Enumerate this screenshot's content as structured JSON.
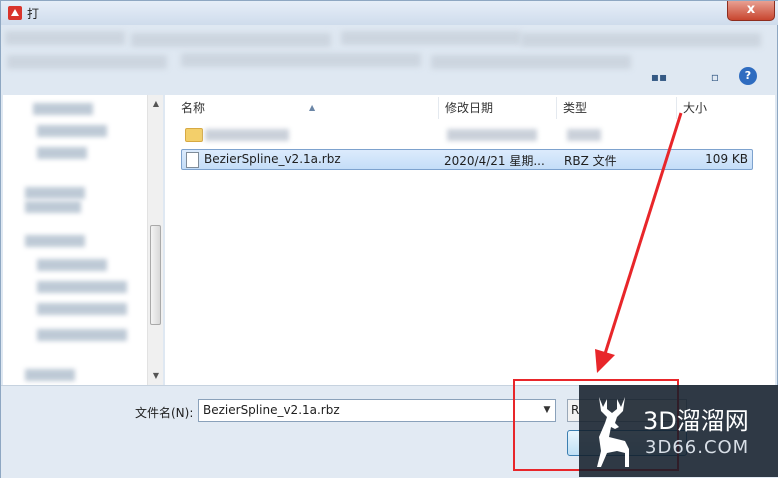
{
  "window": {
    "title": "打"
  },
  "controls": {
    "close_glyph": "x"
  },
  "toolbar": {
    "help_glyph": "?"
  },
  "columns": {
    "name": "名称",
    "date": "修改日期",
    "type": "类型",
    "size": "大小"
  },
  "files": [
    {
      "name": "BezierSpline_v2.1a.rbz",
      "date": "2020/4/21 星期...",
      "type": "RBZ 文件",
      "size": "109 KB",
      "selected": true
    }
  ],
  "footer": {
    "filename_label": "文件名(N):",
    "filename_value": "BezierSpline_v2.1a.rbz",
    "filter_value": "R"
  },
  "watermark": {
    "title": "3D溜溜网",
    "subtitle": "3D66.COM"
  },
  "colors": {
    "accent": "#e8262a",
    "selection": "#c4ddf8",
    "watermark_bg": "#121c28"
  }
}
